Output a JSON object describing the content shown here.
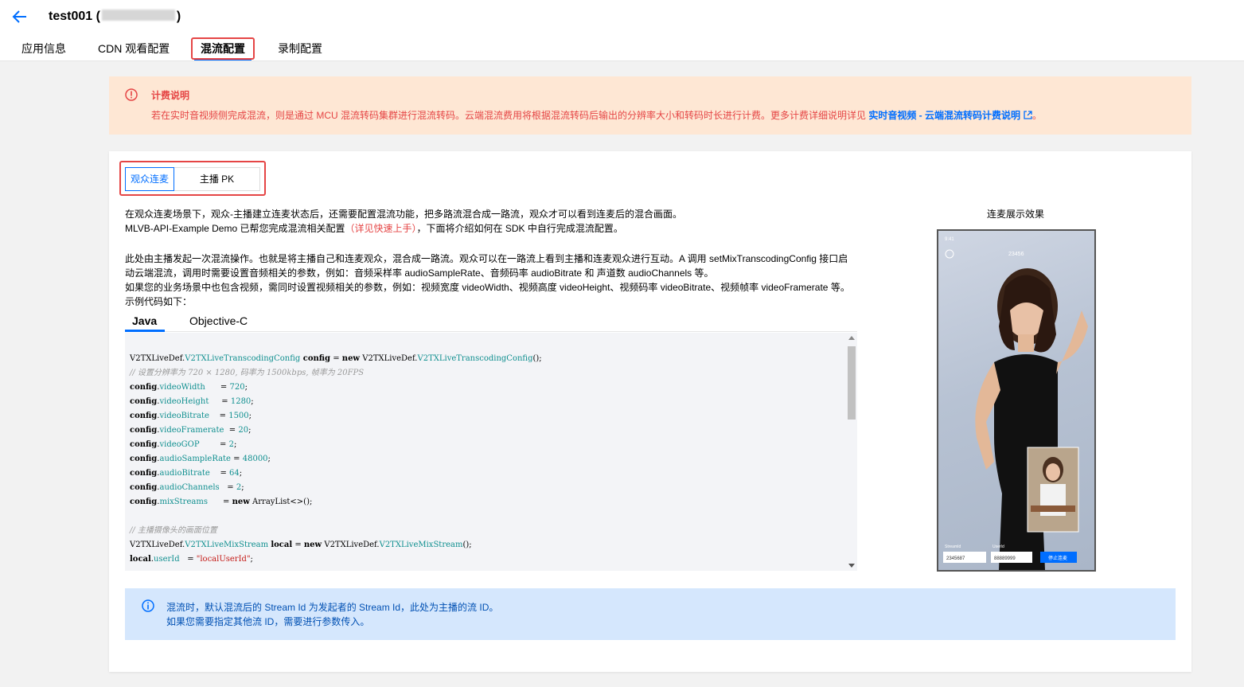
{
  "header": {
    "title": "test001 (",
    "title_suffix": ")",
    "tabs": [
      {
        "label": "应用信息"
      },
      {
        "label": "CDN 观看配置"
      },
      {
        "label": "混流配置"
      },
      {
        "label": "录制配置"
      }
    ]
  },
  "notice": {
    "title": "计费说明",
    "text": "若在实时音视频侧完成混流，则是通过 MCU 混流转码集群进行混流转码。云端混流费用将根据混流转码后输出的分辨率大小和转码时长进行计费。更多计费详细说明详见 ",
    "link": "实时音视频 - 云端混流转码计费说明",
    "end": "。"
  },
  "mode_tabs": [
    {
      "label": "观众连麦"
    },
    {
      "label": "主播 PK"
    }
  ],
  "intro": {
    "line1": "在观众连麦场景下，观众-主播建立连麦状态后，还需要配置混流功能，把多路流混合成一路流，观众才可以看到连麦后的混合画面。",
    "line2_a": "MLVB-API-Example Demo 已帮您完成混流相关配置",
    "line2_red": "（详见快速上手）",
    "line2_b": "，下面将介绍如何在 SDK 中自行完成混流配置。",
    "line3": "此处由主播发起一次混流操作。也就是将主播自己和连麦观众，混合成一路流。观众可以在一路流上看到主播和连麦观众进行互动。A 调用 setMixTranscodingConfig 接口启",
    "line4": "动云端混流，调用时需要设置音频相关的参数，例如：音频采样率 audioSampleRate、音频码率 audioBitrate 和 声道数 audioChannels 等。",
    "line5": "如果您的业务场景中也包含视频，需同时设置视频相关的参数，例如：视频宽度 videoWidth、视频高度 videoHeight、视频码率 videoBitrate、视频帧率 videoFramerate 等。",
    "line6": "示例代码如下："
  },
  "code_tabs": [
    {
      "label": "Java"
    },
    {
      "label": "Objective-C"
    }
  ],
  "code": {
    "l1_a": "V2TXLiveDef.",
    "l1_b": "V2TXLiveTranscodingConfig",
    "l1_c": " config",
    " l1_d": "",
    "l1_e": " = ",
    "l1_f": "new",
    "l1_g": " V2TXLiveDef.",
    "l1_h": "V2TXLiveTranscodingConfig",
    "l1_i": "();",
    "l2": "// 设置分辨率为 720 × 1280, 码率为 1500kbps, 帧率为 20FPS",
    "fields": [
      {
        "name": "videoWidth",
        "pad": "      ",
        "value": "720"
      },
      {
        "name": "videoHeight",
        "pad": "     ",
        "value": "1280"
      },
      {
        "name": "videoBitrate",
        "pad": "    ",
        "value": "1500"
      },
      {
        "name": "videoFramerate",
        "pad": "  ",
        "value": "20"
      },
      {
        "name": "videoGOP",
        "pad": "        ",
        "value": "2"
      },
      {
        "name": "audioSampleRate",
        "pad": " ",
        "value": "48000"
      },
      {
        "name": "audioBitrate",
        "pad": "    ",
        "value": "64"
      },
      {
        "name": "audioChannels",
        "pad": "   ",
        "value": "2"
      }
    ],
    "mix_name": "mixStreams",
    "mix_pad": "      ",
    "mix_value": "ArrayList<>()",
    "l_comment2": "// 主播摄像头的画面位置",
    "local_type": "V2TXLiveMixStream",
    "local_var": "local",
    "userid_field": "userId",
    "userid_value": "\"localUserId\"",
    "obj": "config",
    "kw_new": "new",
    "prefix": "V2TXLiveDef."
  },
  "demo": {
    "title": "连麦展示效果",
    "room_id": "23456",
    "field1_label": "StreamId",
    "field1_value": "2345687",
    "field2_label": "UserId",
    "field2_value": "88889999",
    "stop_button": "停止连麦"
  },
  "info": {
    "line1": "混流时，默认混流后的 Stream Id 为发起者的 Stream Id，此处为主播的流 ID。",
    "line2": "如果您需要指定其他流 ID，需要进行参数传入。"
  },
  "colors": {
    "primary": "#006eff",
    "warning_bg": "#fee7d4",
    "warning_text": "#e54545",
    "info_bg": "#d5e7fd",
    "highlight_box": "#e54545"
  }
}
